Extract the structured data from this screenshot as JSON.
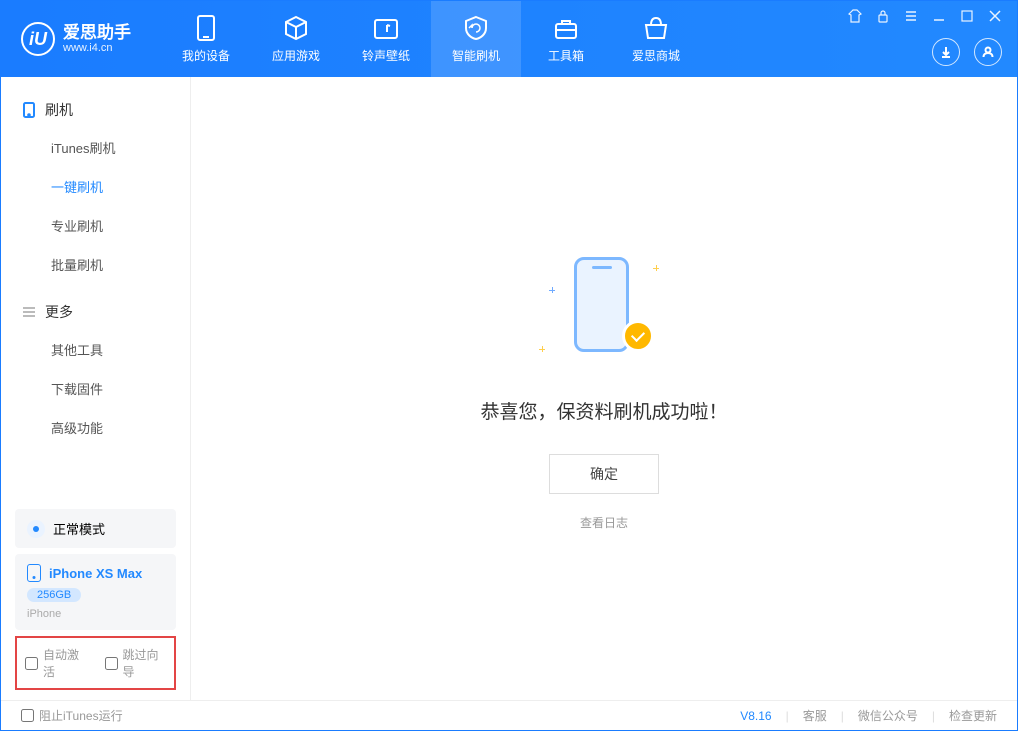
{
  "logo": {
    "cn": "爱思助手",
    "url": "www.i4.cn",
    "mark": "iU"
  },
  "nav": [
    {
      "key": "device",
      "label": "我的设备"
    },
    {
      "key": "apps",
      "label": "应用游戏"
    },
    {
      "key": "ringwall",
      "label": "铃声壁纸"
    },
    {
      "key": "flash",
      "label": "智能刷机"
    },
    {
      "key": "toolbox",
      "label": "工具箱"
    },
    {
      "key": "store",
      "label": "爱思商城"
    }
  ],
  "sidebar": {
    "group1": {
      "title": "刷机",
      "items": [
        {
          "label": "iTunes刷机"
        },
        {
          "label": "一键刷机"
        },
        {
          "label": "专业刷机"
        },
        {
          "label": "批量刷机"
        }
      ]
    },
    "group2": {
      "title": "更多",
      "items": [
        {
          "label": "其他工具"
        },
        {
          "label": "下载固件"
        },
        {
          "label": "高级功能"
        }
      ]
    },
    "mode": "正常模式",
    "device": {
      "name": "iPhone XS Max",
      "capacity": "256GB",
      "type": "iPhone"
    },
    "checkboxes": {
      "autoActivate": "自动激活",
      "skipWizard": "跳过向导"
    }
  },
  "main": {
    "successText": "恭喜您，保资料刷机成功啦！",
    "okButton": "确定",
    "logLink": "查看日志"
  },
  "statusbar": {
    "blockItunes": "阻止iTunes运行",
    "version": "V8.16",
    "links": {
      "service": "客服",
      "wechat": "微信公众号",
      "update": "检查更新"
    }
  }
}
